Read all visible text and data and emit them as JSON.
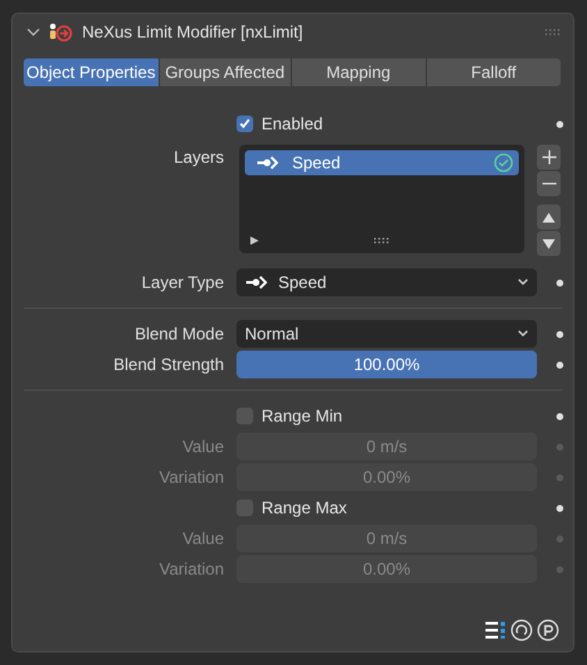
{
  "panel": {
    "title": "NeXus Limit Modifier [nxLimit]",
    "expanded": true
  },
  "tabs": [
    {
      "label": "Object Properties",
      "selected": true
    },
    {
      "label": "Groups Affected",
      "selected": false
    },
    {
      "label": "Mapping",
      "selected": false
    },
    {
      "label": "Falloff",
      "selected": false
    }
  ],
  "rows": [
    {
      "kind": "checkbox",
      "label": "Enabled",
      "checked": true,
      "disabled": false
    },
    {
      "kind": "list",
      "label": "Layers",
      "items": [
        {
          "name": "Speed",
          "selected": true,
          "enabled": true
        }
      ]
    },
    {
      "kind": "dropdown",
      "label": "Layer Type",
      "value": "Speed",
      "has_icon": true
    },
    {
      "kind": "separator"
    },
    {
      "kind": "dropdown",
      "label": "Blend Mode",
      "value": "Normal",
      "has_icon": false
    },
    {
      "kind": "slider",
      "label": "Blend Strength",
      "value": "100.00%",
      "level": 1
    },
    {
      "kind": "separator"
    },
    {
      "kind": "checkbox",
      "label": "Range Min",
      "checked": false,
      "disabled": false
    },
    {
      "kind": "number",
      "label": "Value",
      "value": "0 m/s",
      "disabled": true
    },
    {
      "kind": "number",
      "label": "Variation",
      "value": "0.00%",
      "disabled": true
    },
    {
      "kind": "checkbox",
      "label": "Range Max",
      "checked": false,
      "disabled": false
    },
    {
      "kind": "number",
      "label": "Value",
      "value": "0 m/s",
      "disabled": true
    },
    {
      "kind": "number",
      "label": "Variation",
      "value": "0.00%",
      "disabled": true
    }
  ]
}
